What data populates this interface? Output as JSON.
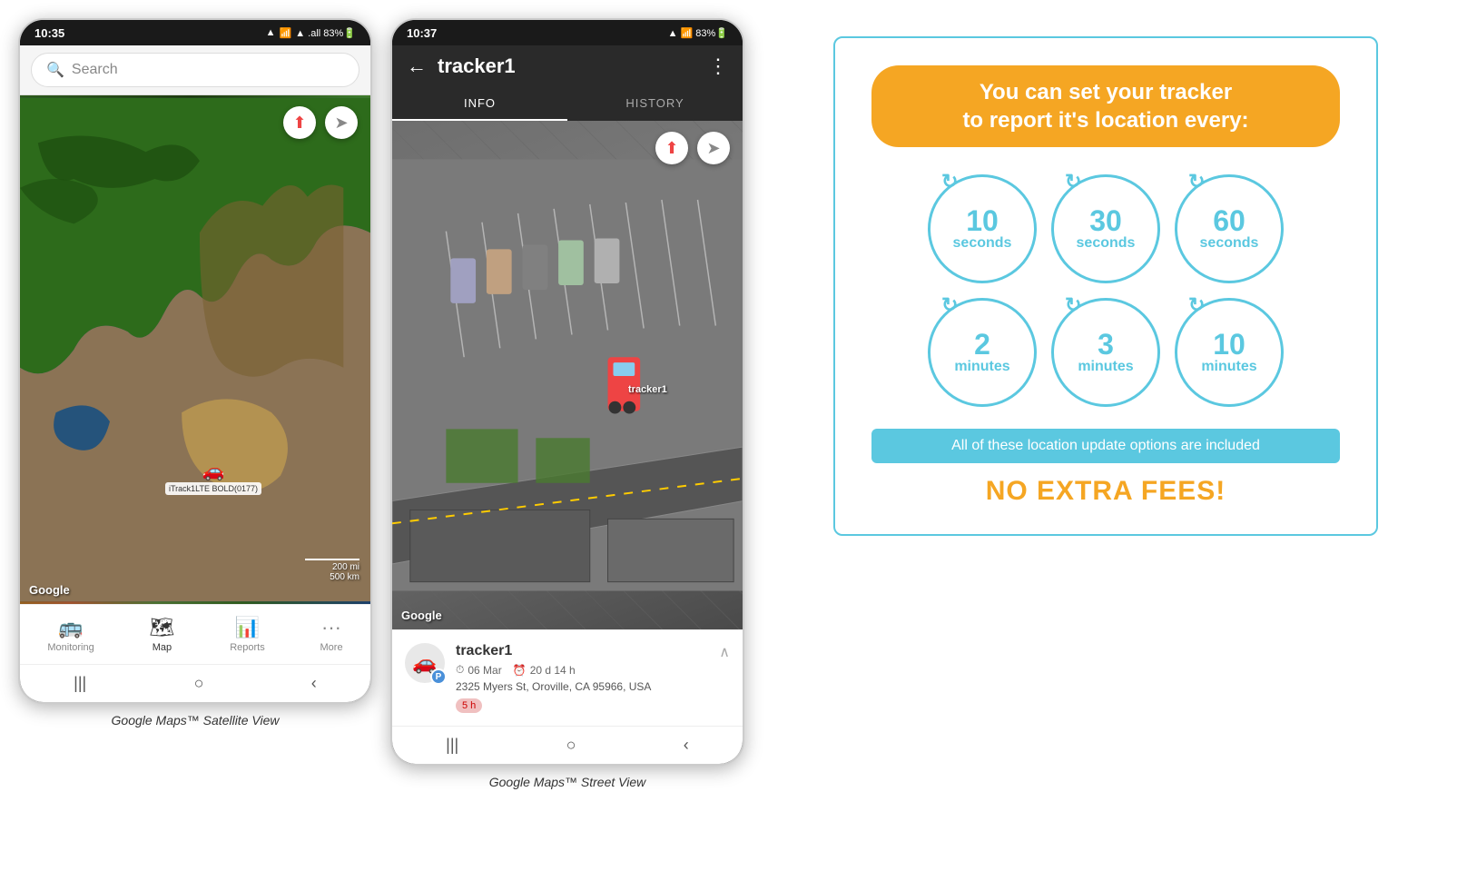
{
  "phone1": {
    "status_time": "10:35",
    "status_icons": "▲ .all 83%🔋",
    "search_placeholder": "Search",
    "map_type": "satellite",
    "google_label": "Google",
    "scale_200mi": "200 mi",
    "scale_500km": "500 km",
    "tracker_label": "iTrack1LTE BOLD(0177)",
    "compass_symbol": "⬆",
    "navigate_symbol": "➤",
    "nav_items": [
      {
        "icon": "🚌",
        "label": "Monitoring",
        "active": false
      },
      {
        "icon": "🗺",
        "label": "Map",
        "active": true
      },
      {
        "icon": "📊",
        "label": "Reports",
        "active": false
      },
      {
        "icon": "•••",
        "label": "More",
        "active": false
      }
    ],
    "sys_nav": [
      "|||",
      "○",
      "‹"
    ]
  },
  "phone2": {
    "status_time": "10:37",
    "status_icons": "▲ .all 83%🔋",
    "header_title": "tracker1",
    "back_symbol": "←",
    "menu_symbol": "⋮",
    "tab_info": "INFO",
    "tab_history": "HISTORY",
    "active_tab": "INFO",
    "map_type": "street",
    "google_label": "Google",
    "tracker_car": "🚗",
    "tracker_label2": "tracker1",
    "compass_symbol": "⬆",
    "navigate_symbol": "➤",
    "info_name": "tracker1",
    "info_car_icon": "🚗",
    "info_date": "06 Mar",
    "info_duration": "20 d 14 h",
    "info_address": "2325 Myers St, Oroville, CA 95966, USA",
    "info_badge": "5 h",
    "info_parking_label": "P",
    "sys_nav": [
      "|||",
      "○",
      "‹"
    ]
  },
  "info_card": {
    "headline": "You can set your tracker\nto report it's location every:",
    "intervals": [
      {
        "number": "10",
        "unit": "seconds"
      },
      {
        "number": "30",
        "unit": "seconds"
      },
      {
        "number": "60",
        "unit": "seconds"
      },
      {
        "number": "2",
        "unit": "minutes"
      },
      {
        "number": "3",
        "unit": "minutes"
      },
      {
        "number": "10",
        "unit": "minutes"
      }
    ],
    "included_text": "All of these location update options are included",
    "no_fees_text": "NO EXTRA FEES!",
    "accent_color": "#f5a623",
    "blue_color": "#5bc8e0"
  },
  "captions": {
    "phone1": "Google Maps™ Satellite View",
    "phone2": "Google Maps™ Street View"
  }
}
